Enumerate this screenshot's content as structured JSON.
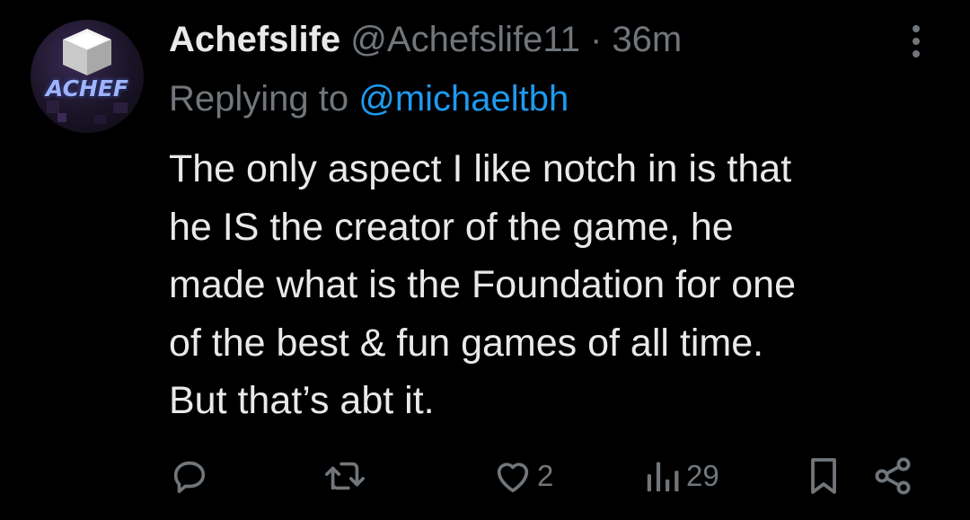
{
  "tweet": {
    "avatar_text": "ACHEF",
    "display_name": "Achefslife",
    "handle": "@Achefslife11",
    "separator": "·",
    "time": "36m",
    "replying_prefix": "Replying to ",
    "replying_to": "@michaeltbh",
    "text": "The only aspect I like notch in is that\nhe IS the creator of the game, he\nmade what is the Foundation for one\nof the best & fun games of all time.\nBut that’s abt it.",
    "actions": {
      "reply_icon": "reply-icon",
      "retweet_icon": "retweet-icon",
      "like_icon": "heart-icon",
      "like_count": "2",
      "views_icon": "views-icon",
      "views_count": "29",
      "bookmark_icon": "bookmark-icon",
      "share_icon": "share-icon"
    }
  },
  "colors": {
    "background": "#000000",
    "text_primary": "#e7e9ea",
    "text_secondary": "#71767b",
    "link": "#1d9bf0"
  }
}
